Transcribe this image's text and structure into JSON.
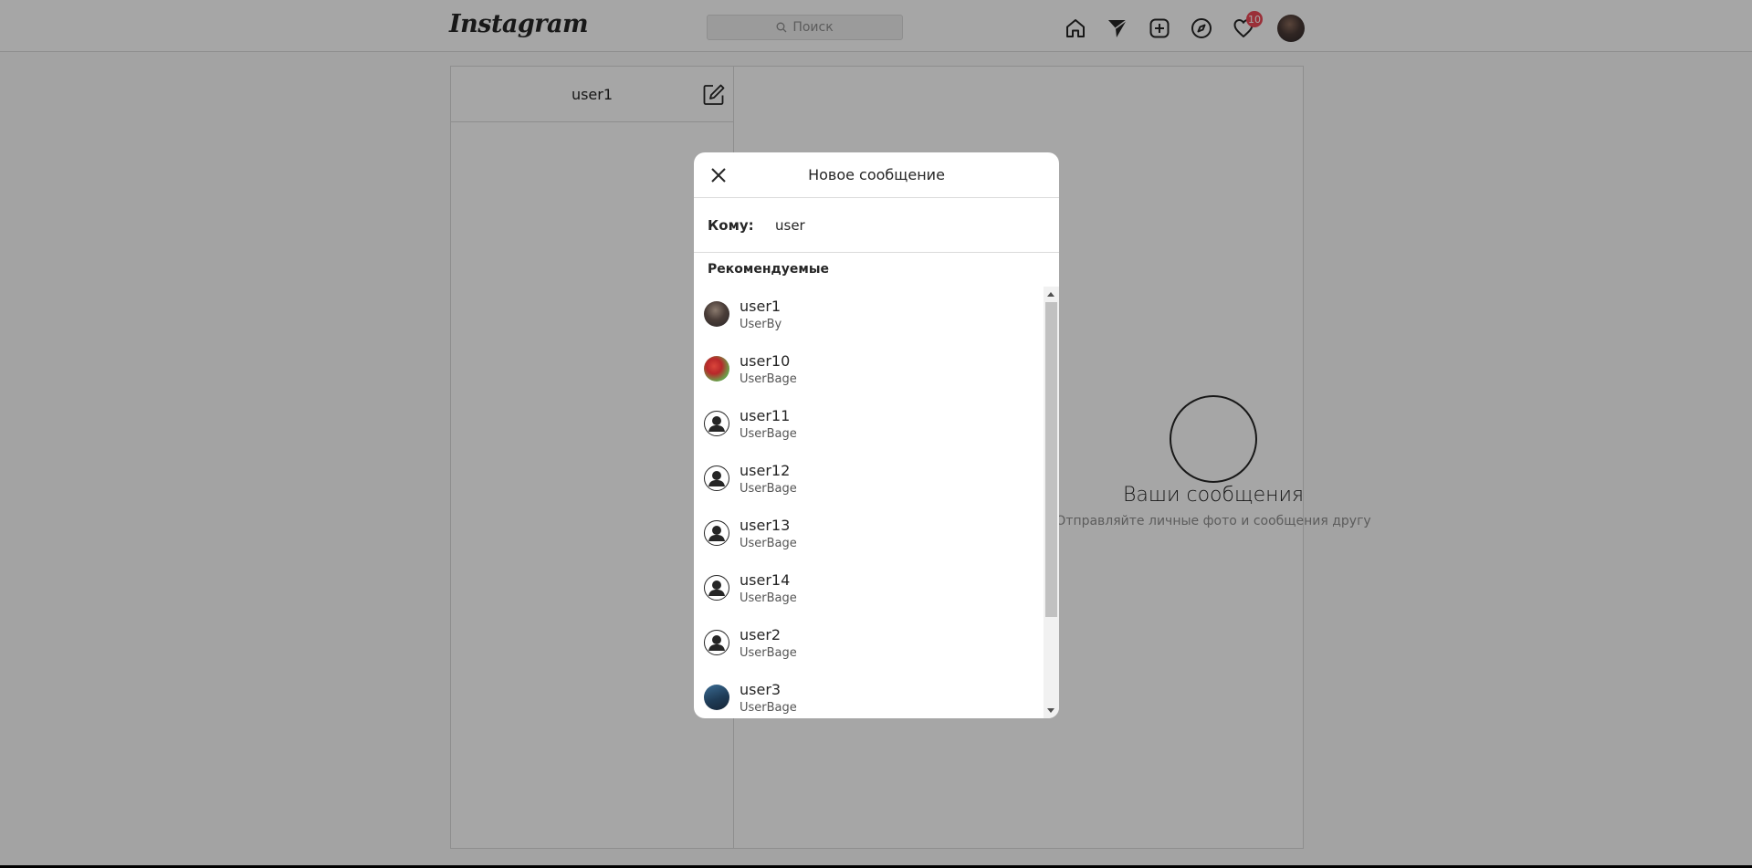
{
  "nav": {
    "logo": "Instagram",
    "search_placeholder": "Поиск",
    "icons": [
      "home-icon",
      "direct-icon",
      "new-post-icon",
      "explore-icon",
      "activity-icon"
    ],
    "notifications_count": "10"
  },
  "direct": {
    "username": "user1",
    "empty_title": "Ваши сообщения",
    "empty_subtitle": "Отправляйте личные фото и сообщения другу"
  },
  "modal": {
    "title": "Новое сообщение",
    "to_label": "Кому:",
    "to_value": "user",
    "suggested_title": "Рекомендуемые",
    "users": [
      {
        "name": "user1",
        "full_name": "UserBy",
        "avatar": "photo"
      },
      {
        "name": "user10",
        "full_name": "UserBage",
        "avatar": "photo"
      },
      {
        "name": "user11",
        "full_name": "UserBage",
        "avatar": "default"
      },
      {
        "name": "user12",
        "full_name": "UserBage",
        "avatar": "default"
      },
      {
        "name": "user13",
        "full_name": "UserBage",
        "avatar": "default"
      },
      {
        "name": "user14",
        "full_name": "UserBage",
        "avatar": "default"
      },
      {
        "name": "user2",
        "full_name": "UserBage",
        "avatar": "default"
      },
      {
        "name": "user3",
        "full_name": "UserBage",
        "avatar": "photo"
      }
    ]
  },
  "colors": {
    "overlay": "rgba(0,0,0,0.35)",
    "badge": "#ed4956",
    "border": "#dbdbdb",
    "text": "#262626"
  }
}
